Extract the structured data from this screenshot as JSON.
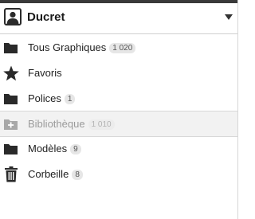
{
  "header": {
    "username": "Ducret",
    "avatar_icon": "user-avatar-icon",
    "menu_icon": "dropdown-caret-icon"
  },
  "nav": {
    "items": [
      {
        "label": "Tous Graphiques",
        "count": "1 020",
        "icon": "folder-icon"
      },
      {
        "label": "Favoris",
        "count": "",
        "icon": "star-icon"
      },
      {
        "label": "Polices",
        "count": "1",
        "icon": "folder-icon"
      },
      {
        "label": "Bibliothèque",
        "count": "1 010",
        "icon": "add-folder-icon",
        "selected": true
      },
      {
        "label": "Modèles",
        "count": "9",
        "icon": "folder-icon"
      },
      {
        "label": "Corbeille",
        "count": "8",
        "icon": "trash-icon"
      }
    ]
  },
  "colors": {
    "icon": "#2a2a2a",
    "icon_muted": "#a8a8a8",
    "selected_bg": "#f2f2f2",
    "badge_bg": "#e6e6e6"
  }
}
